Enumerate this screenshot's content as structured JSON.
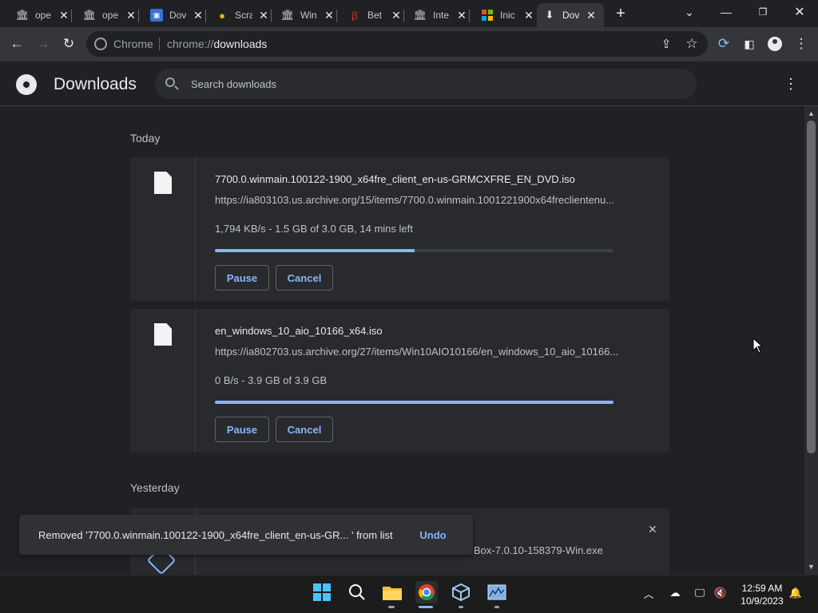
{
  "tabs": [
    {
      "title": "ope",
      "icon": "archive-icon",
      "active": false
    },
    {
      "title": "ope",
      "icon": "archive-icon",
      "active": false
    },
    {
      "title": "Dov",
      "icon": "blue-window-icon",
      "active": false
    },
    {
      "title": "Scra",
      "icon": "coin-icon",
      "active": false
    },
    {
      "title": "Win",
      "icon": "archive-icon",
      "active": false
    },
    {
      "title": "Bet",
      "icon": "betaarchive-icon",
      "active": false
    },
    {
      "title": "Inte",
      "icon": "archive-icon",
      "active": false
    },
    {
      "title": "Inic",
      "icon": "windows-logo-icon",
      "active": false
    },
    {
      "title": "Dov",
      "icon": "download-icon",
      "active": true
    }
  ],
  "omnibox": {
    "chip": "Chrome",
    "url_prefix": "chrome://",
    "url_path": "downloads"
  },
  "header": {
    "title": "Downloads",
    "search_placeholder": "Search downloads"
  },
  "sections": {
    "today": "Today",
    "yesterday": "Yesterday"
  },
  "downloads": [
    {
      "name": "7700.0.winmain.100122-1900_x64fre_client_en-us-GRMCXFRE_EN_DVD.iso",
      "url": "https://ia803103.us.archive.org/15/items/7700.0.winmain.1001221900x64freclientenu...",
      "status": "1,794 KB/s - 1.5 GB of 3.0 GB, 14 mins left",
      "progress": 0.5,
      "pause_label": "Pause",
      "cancel_label": "Cancel"
    },
    {
      "name": "en_windows_10_aio_10166_x64.iso",
      "url": "https://ia802703.us.archive.org/27/items/Win10AIO10166/en_windows_10_aio_10166...",
      "status": "0 B/s - 3.9 GB of 3.9 GB",
      "progress": 1.0,
      "pause_label": "Pause",
      "cancel_label": "Cancel"
    }
  ],
  "yesterday_item": {
    "partial_name": "Box-7.0.10-158379-Win.exe"
  },
  "toast": {
    "message": "Removed '7700.0.winmain.100122-1900_x64fre_client_en-us-GR...  ' from list",
    "undo_label": "Undo"
  },
  "clock": {
    "time": "12:59 AM",
    "date": "10/9/2023"
  },
  "colors": {
    "accent": "#8ab4f8",
    "background": "#202124",
    "card": "#292a2d"
  }
}
